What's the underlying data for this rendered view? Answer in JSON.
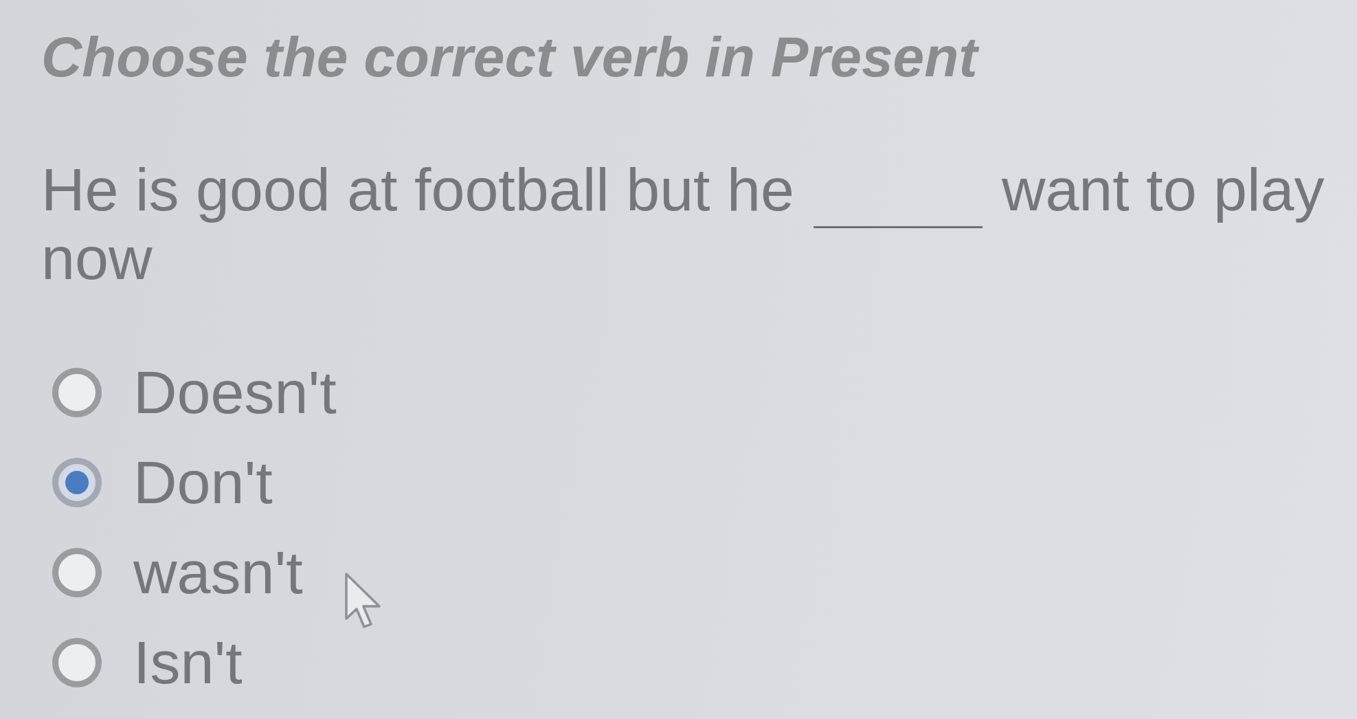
{
  "title": "Choose the correct verb in Present",
  "sentence": [
    {
      "kind": "text",
      "text": "He is good at football but he"
    },
    {
      "kind": "blank"
    },
    {
      "kind": "text",
      "text": "want to play"
    },
    {
      "kind": "text",
      "text": "now"
    }
  ],
  "options": [
    {
      "label": "Doesn't",
      "selected": false
    },
    {
      "label": "Don't",
      "selected": true
    },
    {
      "label": "wasn't",
      "selected": false
    },
    {
      "label": "Isn't",
      "selected": false
    }
  ]
}
